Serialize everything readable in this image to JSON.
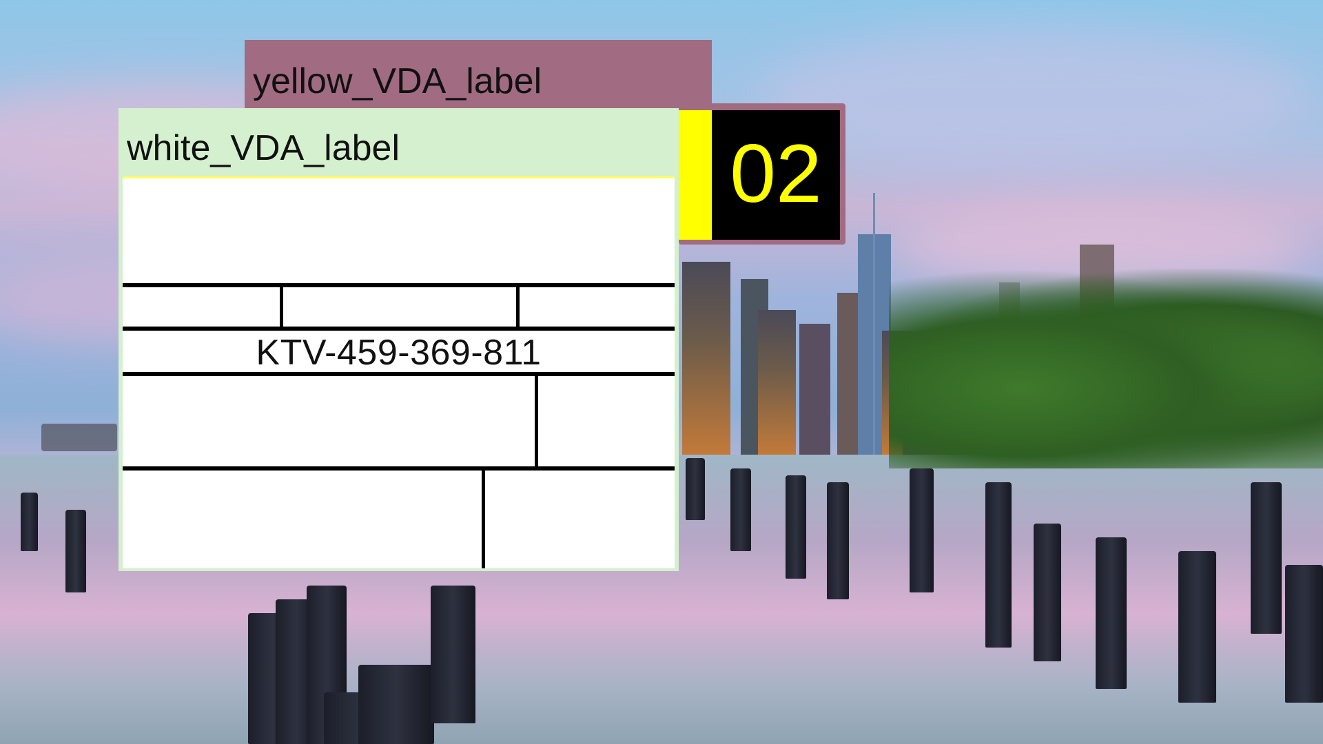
{
  "panels": {
    "yellow_label": "yellow_VDA_label",
    "white_label": "white_VDA_label",
    "number": "02",
    "code": "KTV-459-369-811"
  },
  "colors": {
    "yellow_panel_bg": "#a16b82",
    "white_panel_bg": "#d4f0cf",
    "number_bg": "#000000",
    "number_fg": "#ffff00",
    "accent_yellow": "#ffff00"
  }
}
